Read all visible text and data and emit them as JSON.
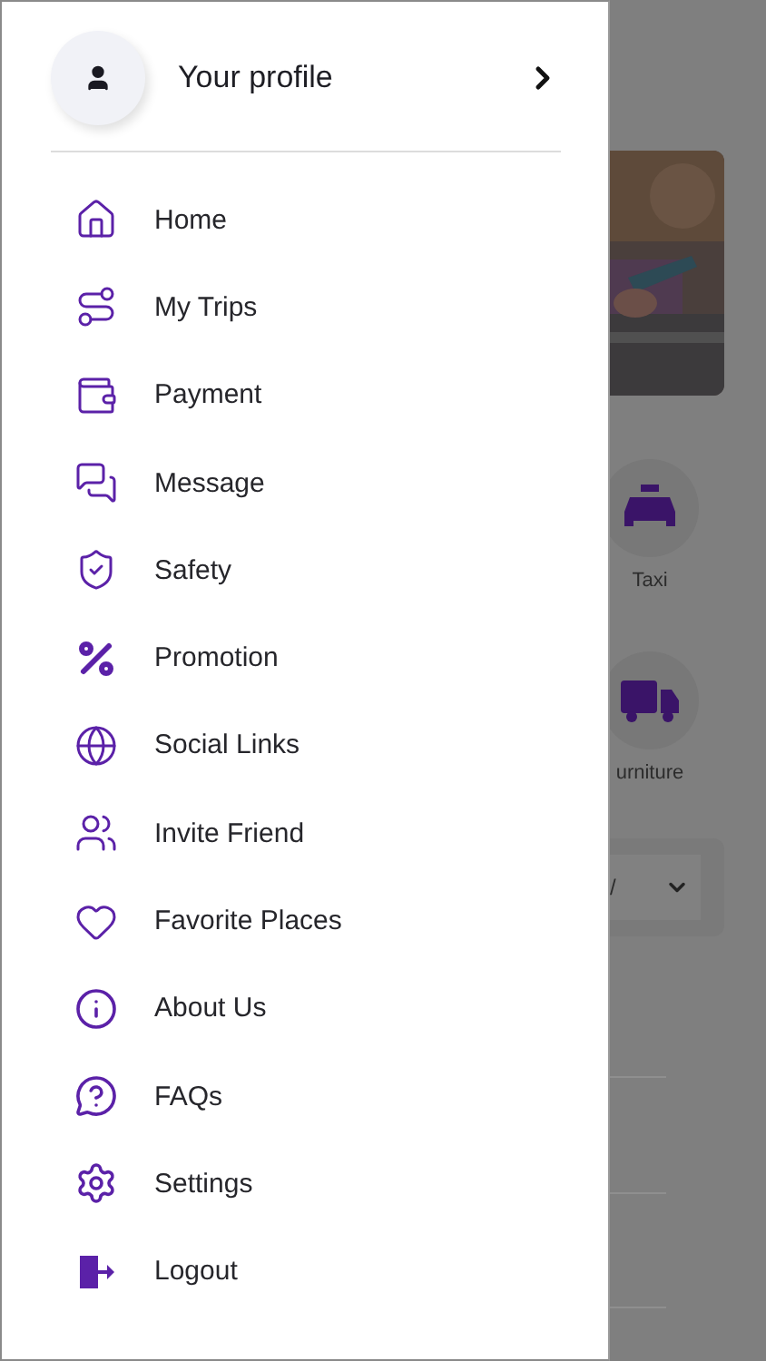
{
  "drawer": {
    "profile": {
      "label": "Your profile"
    },
    "menu": [
      {
        "label": "Home"
      },
      {
        "label": "My Trips"
      },
      {
        "label": "Payment"
      },
      {
        "label": "Message"
      },
      {
        "label": "Safety"
      },
      {
        "label": "Promotion"
      },
      {
        "label": "Social Links"
      },
      {
        "label": "Invite Friend"
      },
      {
        "label": "Favorite Places"
      },
      {
        "label": "About Us"
      },
      {
        "label": "FAQs"
      },
      {
        "label": "Settings"
      },
      {
        "label": "Logout"
      }
    ]
  },
  "background": {
    "services": [
      {
        "label": "Taxi",
        "kind": "taxi"
      },
      {
        "label": "urniture",
        "kind": "furniture"
      }
    ],
    "dropdown": {
      "value": "/"
    }
  }
}
